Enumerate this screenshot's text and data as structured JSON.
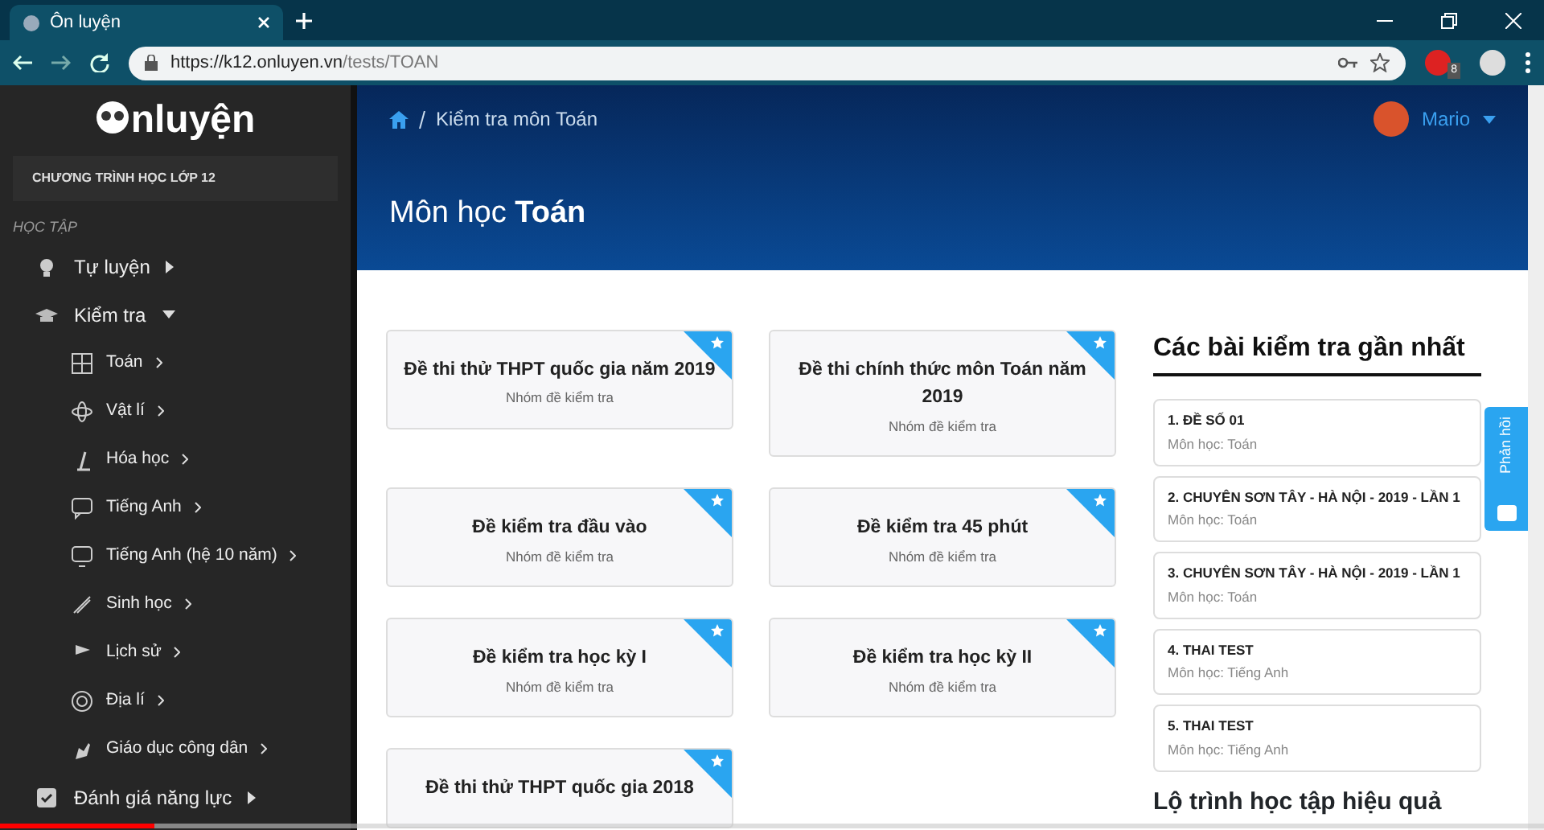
{
  "browser": {
    "tab_title": "Ôn luyện",
    "url_host": "https://k12.onluyen.vn",
    "url_path": "/tests/TOAN",
    "extension_badge": "8"
  },
  "sidebar": {
    "logo": "nluyện",
    "program": "CHƯƠNG TRÌNH HỌC LỚP 12",
    "section": "HỌC TẬP",
    "items": [
      {
        "label": "Tự luyện",
        "expanded": false
      },
      {
        "label": "Kiểm tra",
        "expanded": true,
        "children": [
          {
            "label": "Toán"
          },
          {
            "label": "Vật lí"
          },
          {
            "label": "Hóa học"
          },
          {
            "label": "Tiếng Anh"
          },
          {
            "label": "Tiếng Anh (hệ 10 năm)"
          },
          {
            "label": "Sinh học"
          },
          {
            "label": "Lịch sử"
          },
          {
            "label": "Địa lí"
          },
          {
            "label": "Giáo dục công dân"
          }
        ]
      },
      {
        "label": "Đánh giá năng lực",
        "expanded": false
      }
    ]
  },
  "header": {
    "breadcrumb": "Kiểm tra môn Toán",
    "user": "Mario",
    "title": "Môn học **Toán**"
  },
  "cards": [
    {
      "title": "Đề thi thử THPT quốc gia năm 2019",
      "subtitle": "Nhóm đề kiểm tra"
    },
    {
      "title": "Đề thi chính thức môn Toán năm 2019",
      "subtitle": "Nhóm đề kiểm tra"
    },
    {
      "title": "Đề kiểm tra đầu vào",
      "subtitle": "Nhóm đề kiểm tra"
    },
    {
      "title": "Đề kiểm tra 45 phút",
      "subtitle": "Nhóm đề kiểm tra"
    },
    {
      "title": "Đề kiểm tra học kỳ I",
      "subtitle": "Nhóm đề kiểm tra"
    },
    {
      "title": "Đề kiểm tra học kỳ II",
      "subtitle": "Nhóm đề kiểm tra"
    },
    {
      "title": "Đề thi thử THPT quốc gia 2018"
    }
  ],
  "recent": {
    "heading": "Các bài kiểm tra gần nhất",
    "items": [
      {
        "title": "1. ĐỀ SỐ 01",
        "subject": "Môn học: Toán"
      },
      {
        "title": "2. CHUYÊN SƠN TÂY - HÀ NỘI - 2019 - LẦN 1",
        "subject": "Môn học: Toán"
      },
      {
        "title": "3. CHUYÊN SƠN TÂY - HÀ NỘI - 2019 - LẦN 1",
        "subject": "Môn học: Toán"
      },
      {
        "title": "4. THAI TEST",
        "subject": "Môn học: Tiếng Anh"
      },
      {
        "title": "5. THAI TEST",
        "subject": "Môn học: Tiếng Anh"
      }
    ],
    "next_heading": "Lộ trình học tập hiệu quả"
  },
  "feedback": "Phản hồi",
  "video_progress": {
    "level": 0.1
  }
}
